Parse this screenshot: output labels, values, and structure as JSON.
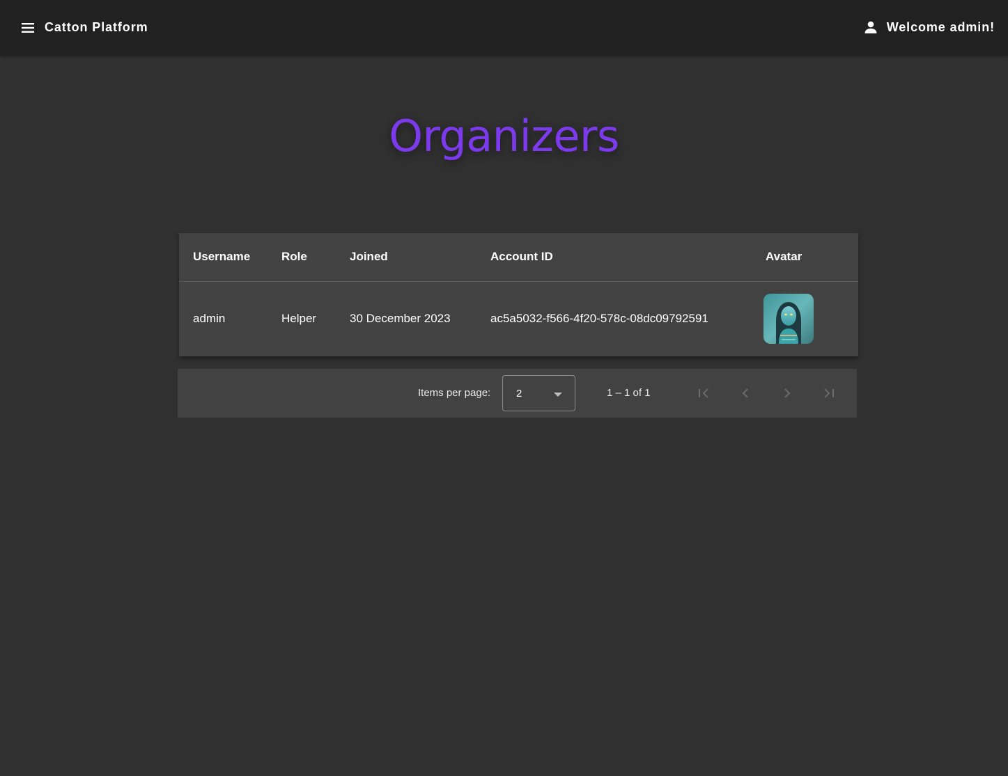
{
  "header": {
    "menu_icon": "menu-icon",
    "app_title": "Catton Platform",
    "user_icon": "person-icon",
    "welcome_text": "Welcome admin!"
  },
  "page": {
    "title": "Organizers",
    "title_color": "#7c3aed"
  },
  "table": {
    "columns": {
      "username": "Username",
      "role": "Role",
      "joined": "Joined",
      "account_id": "Account ID",
      "avatar": "Avatar"
    },
    "rows": [
      {
        "username": "admin",
        "role": "Helper",
        "joined": "30 December 2023",
        "account_id": "ac5a5032-f566-4f20-578c-08dc09792591",
        "avatar": "avatar-image"
      }
    ]
  },
  "paginator": {
    "items_per_page_label": "Items per page:",
    "items_per_page_value": "2",
    "range_label": "1 – 1 of 1",
    "first_icon": "first-page-icon",
    "prev_icon": "chevron-left-icon",
    "next_icon": "chevron-right-icon",
    "last_icon": "last-page-icon",
    "disabled_color": "#6b6b6b"
  }
}
